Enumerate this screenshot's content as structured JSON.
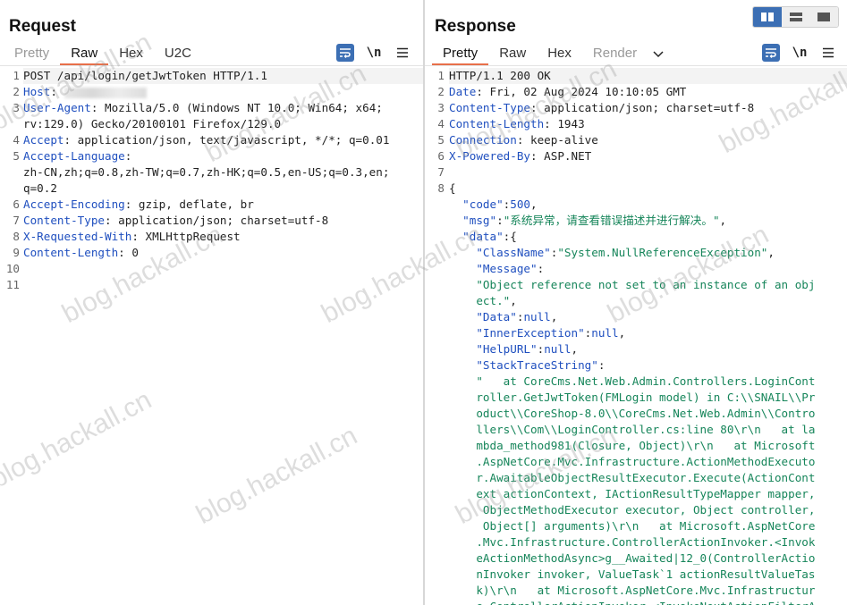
{
  "request": {
    "title": "Request",
    "tabs": [
      "Pretty",
      "Raw",
      "Hex",
      "U2C"
    ],
    "active_tab": "Raw",
    "tools": {
      "wrap_icon": "wrap-lines-icon",
      "newline_label": "\\n",
      "menu_icon": "hamburger-menu-icon"
    },
    "line_numbers": [
      "1",
      "2",
      "3",
      "",
      "4",
      "5",
      "",
      "",
      "6",
      "7",
      "8",
      "9",
      "10",
      "11"
    ],
    "lines": [
      [
        {
          "t": "POST /api/login/getJwtToken HTTP/1.1",
          "c": "pc"
        }
      ],
      [
        {
          "t": "Host",
          "c": "hk"
        },
        {
          "t": ": ",
          "c": "pc"
        },
        {
          "blur": true
        }
      ],
      [
        {
          "t": "User-Agent",
          "c": "hk"
        },
        {
          "t": ": Mozilla/5.0 (Windows NT 10.0; Win64; x64;",
          "c": "pc"
        }
      ],
      [
        {
          "t": "rv:129.0) Gecko/20100101 Firefox/129.0",
          "c": "pc"
        }
      ],
      [
        {
          "t": "Accept",
          "c": "hk"
        },
        {
          "t": ": application/json, text/javascript, */*; q=0.01",
          "c": "pc"
        }
      ],
      [
        {
          "t": "Accept-Language",
          "c": "hk"
        },
        {
          "t": ":",
          "c": "pc"
        }
      ],
      [
        {
          "t": "zh-CN,zh;q=0.8,zh-TW;q=0.7,zh-HK;q=0.5,en-US;q=0.3,en;",
          "c": "pc"
        }
      ],
      [
        {
          "t": "q=0.2",
          "c": "pc"
        }
      ],
      [
        {
          "t": "Accept-Encoding",
          "c": "hk"
        },
        {
          "t": ": gzip, deflate, br",
          "c": "pc"
        }
      ],
      [
        {
          "t": "Content-Type",
          "c": "hk"
        },
        {
          "t": ": application/json; charset=utf-8",
          "c": "pc"
        }
      ],
      [
        {
          "t": "X-Requested-With",
          "c": "hk"
        },
        {
          "t": ": XMLHttpRequest",
          "c": "pc"
        }
      ],
      [
        {
          "t": "Content-Length",
          "c": "hk"
        },
        {
          "t": ": 0",
          "c": "pc"
        }
      ],
      [],
      []
    ]
  },
  "response": {
    "title": "Response",
    "tabs": [
      "Pretty",
      "Raw",
      "Hex",
      "Render"
    ],
    "active_tab": "Pretty",
    "muted_tab": "Render",
    "tools": {
      "wrap_icon": "wrap-lines-icon",
      "newline_label": "\\n",
      "menu_icon": "hamburger-menu-icon",
      "dropdown_icon": "chevron-down-icon"
    },
    "line_numbers": [
      "1",
      "2",
      "3",
      "4",
      "5",
      "6",
      "7",
      "8",
      "",
      "",
      "",
      "",
      "",
      "",
      "",
      "",
      "",
      "",
      "",
      "",
      "",
      "",
      "",
      "",
      "",
      "",
      "",
      "",
      "",
      "",
      "",
      "",
      "",
      ""
    ],
    "lines": [
      [
        {
          "t": "HTTP/1.1 200 OK",
          "c": "pc"
        }
      ],
      [
        {
          "t": "Date",
          "c": "hk"
        },
        {
          "t": ": Fri, 02 Aug 2024 10:10:05 GMT",
          "c": "pc"
        }
      ],
      [
        {
          "t": "Content-Type",
          "c": "hk"
        },
        {
          "t": ": application/json; charset=utf-8",
          "c": "pc"
        }
      ],
      [
        {
          "t": "Content-Length",
          "c": "hk"
        },
        {
          "t": ": 1943",
          "c": "pc"
        }
      ],
      [
        {
          "t": "Connection",
          "c": "hk"
        },
        {
          "t": ": keep-alive",
          "c": "pc"
        }
      ],
      [
        {
          "t": "X-Powered-By",
          "c": "hk"
        },
        {
          "t": ": ASP.NET",
          "c": "pc"
        }
      ],
      [],
      [
        {
          "t": "{",
          "c": "pc"
        }
      ],
      [
        {
          "t": "  ",
          "c": "pc"
        },
        {
          "t": "\"code\"",
          "c": "jk"
        },
        {
          "t": ":",
          "c": "pc"
        },
        {
          "t": "500",
          "c": "jn"
        },
        {
          "t": ",",
          "c": "pc"
        }
      ],
      [
        {
          "t": "  ",
          "c": "pc"
        },
        {
          "t": "\"msg\"",
          "c": "jk"
        },
        {
          "t": ":",
          "c": "pc"
        },
        {
          "t": "\"系统异常，请查看错误描述并进行解决。\"",
          "c": "js"
        },
        {
          "t": ",",
          "c": "pc"
        }
      ],
      [
        {
          "t": "  ",
          "c": "pc"
        },
        {
          "t": "\"data\"",
          "c": "jk"
        },
        {
          "t": ":{",
          "c": "pc"
        }
      ],
      [
        {
          "t": "    ",
          "c": "pc"
        },
        {
          "t": "\"ClassName\"",
          "c": "jk"
        },
        {
          "t": ":",
          "c": "pc"
        },
        {
          "t": "\"System.NullReferenceException\"",
          "c": "js"
        },
        {
          "t": ",",
          "c": "pc"
        }
      ],
      [
        {
          "t": "    ",
          "c": "pc"
        },
        {
          "t": "\"Message\"",
          "c": "jk"
        },
        {
          "t": ":",
          "c": "pc"
        }
      ],
      [
        {
          "t": "    ",
          "c": "pc"
        },
        {
          "t": "\"Object reference not set to an instance of an obj",
          "c": "js"
        }
      ],
      [
        {
          "t": "    ",
          "c": "pc"
        },
        {
          "t": "ect.\"",
          "c": "js"
        },
        {
          "t": ",",
          "c": "pc"
        }
      ],
      [
        {
          "t": "    ",
          "c": "pc"
        },
        {
          "t": "\"Data\"",
          "c": "jk"
        },
        {
          "t": ":",
          "c": "pc"
        },
        {
          "t": "null",
          "c": "jn"
        },
        {
          "t": ",",
          "c": "pc"
        }
      ],
      [
        {
          "t": "    ",
          "c": "pc"
        },
        {
          "t": "\"InnerException\"",
          "c": "jk"
        },
        {
          "t": ":",
          "c": "pc"
        },
        {
          "t": "null",
          "c": "jn"
        },
        {
          "t": ",",
          "c": "pc"
        }
      ],
      [
        {
          "t": "    ",
          "c": "pc"
        },
        {
          "t": "\"HelpURL\"",
          "c": "jk"
        },
        {
          "t": ":",
          "c": "pc"
        },
        {
          "t": "null",
          "c": "jn"
        },
        {
          "t": ",",
          "c": "pc"
        }
      ],
      [
        {
          "t": "    ",
          "c": "pc"
        },
        {
          "t": "\"StackTraceString\"",
          "c": "jk"
        },
        {
          "t": ":",
          "c": "pc"
        }
      ],
      [
        {
          "t": "    ",
          "c": "pc"
        },
        {
          "t": "\"   at CoreCms.Net.Web.Admin.Controllers.LoginCont",
          "c": "js"
        }
      ],
      [
        {
          "t": "    ",
          "c": "pc"
        },
        {
          "t": "roller.GetJwtToken(FMLogin model) in C:\\\\SNAIL\\\\Pr",
          "c": "js"
        }
      ],
      [
        {
          "t": "    ",
          "c": "pc"
        },
        {
          "t": "oduct\\\\CoreShop-8.0\\\\CoreCms.Net.Web.Admin\\\\Contro",
          "c": "js"
        }
      ],
      [
        {
          "t": "    ",
          "c": "pc"
        },
        {
          "t": "llers\\\\Com\\\\LoginController.cs:line 80\\r\\n   at la",
          "c": "js"
        }
      ],
      [
        {
          "t": "    ",
          "c": "pc"
        },
        {
          "t": "mbda_method981(Closure, Object)\\r\\n   at Microsoft",
          "c": "js"
        }
      ],
      [
        {
          "t": "    ",
          "c": "pc"
        },
        {
          "t": ".AspNetCore.Mvc.Infrastructure.ActionMethodExecuto",
          "c": "js"
        }
      ],
      [
        {
          "t": "    ",
          "c": "pc"
        },
        {
          "t": "r.AwaitableObjectResultExecutor.Execute(ActionCont",
          "c": "js"
        }
      ],
      [
        {
          "t": "    ",
          "c": "pc"
        },
        {
          "t": "ext actionContext, IActionResultTypeMapper mapper,",
          "c": "js"
        }
      ],
      [
        {
          "t": "    ",
          "c": "pc"
        },
        {
          "t": " ObjectMethodExecutor executor, Object controller,",
          "c": "js"
        }
      ],
      [
        {
          "t": "    ",
          "c": "pc"
        },
        {
          "t": " Object[] arguments)\\r\\n   at Microsoft.AspNetCore",
          "c": "js"
        }
      ],
      [
        {
          "t": "    ",
          "c": "pc"
        },
        {
          "t": ".Mvc.Infrastructure.ControllerActionInvoker.<Invok",
          "c": "js"
        }
      ],
      [
        {
          "t": "    ",
          "c": "pc"
        },
        {
          "t": "eActionMethodAsync>g__Awaited|12_0(ControllerActio",
          "c": "js"
        }
      ],
      [
        {
          "t": "    ",
          "c": "pc"
        },
        {
          "t": "nInvoker invoker, ValueTask`1 actionResultValueTas",
          "c": "js"
        }
      ],
      [
        {
          "t": "    ",
          "c": "pc"
        },
        {
          "t": "k)\\r\\n   at Microsoft.AspNetCore.Mvc.Infrastructur",
          "c": "js"
        }
      ],
      [
        {
          "t": "    ",
          "c": "pc"
        },
        {
          "t": "e.ControllerActionInvoker.<InvokeNextActionFilterA",
          "c": "js"
        }
      ]
    ]
  },
  "layout_toggle": {
    "options": [
      "split-horizontal-icon",
      "split-vertical-icon",
      "single-pane-icon"
    ],
    "active": 0
  },
  "watermark": "blog.hackall.cn",
  "colors": {
    "accent_tab": "#e8704a",
    "header_key": "#1f4fbf",
    "json_string": "#16855a",
    "button_blue": "#3c6fb4"
  }
}
